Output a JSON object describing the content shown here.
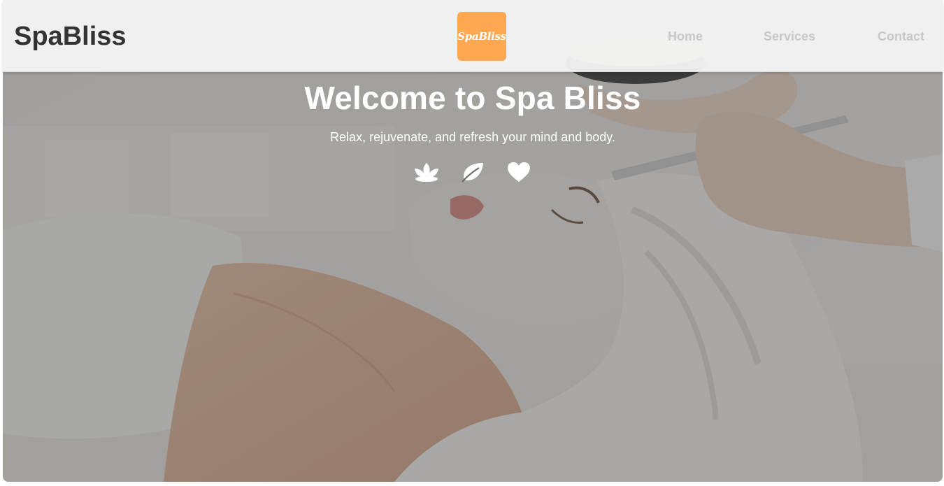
{
  "header": {
    "brand": "SpaBliss",
    "logo_text": "SpaBliss",
    "nav": {
      "home": "Home",
      "services": "Services",
      "contact": "Contact"
    }
  },
  "hero": {
    "title": "Welcome to Spa Bliss",
    "subtitle": "Relax, rejuvenate, and refresh your mind and body.",
    "icons": [
      "lotus-icon",
      "leaf-icon",
      "heart-icon"
    ]
  },
  "colors": {
    "brand_text": "#333333",
    "logo_bg": "#ffa751",
    "nav_text": "#c8c8c8",
    "hero_text": "#ffffff",
    "header_bg": "#f4f4f4"
  }
}
